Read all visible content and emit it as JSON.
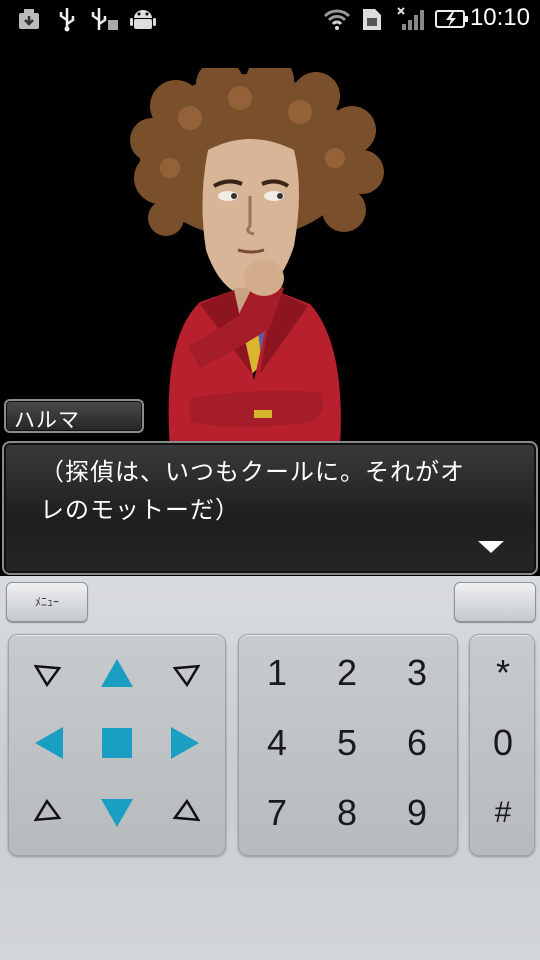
{
  "status_bar": {
    "time": "10:10",
    "icons": [
      "download-icon",
      "usb-icon",
      "usb-debug-icon",
      "android-icon",
      "wifi-icon",
      "sim-icon",
      "signal-icon",
      "battery-charging-icon"
    ]
  },
  "scene": {
    "character_name": "ハルマ",
    "dialog_line1": "（探偵は、いつもクールに。それがオ",
    "dialog_line2": "レのモットーだ）"
  },
  "controls": {
    "menu_label": "ﾒﾆｭｰ",
    "number_keys": [
      "1",
      "2",
      "3",
      "4",
      "5",
      "6",
      "7",
      "8",
      "9"
    ],
    "symbol_keys": [
      "*",
      "0",
      "#"
    ],
    "accent_color": "#1a9fc2"
  }
}
